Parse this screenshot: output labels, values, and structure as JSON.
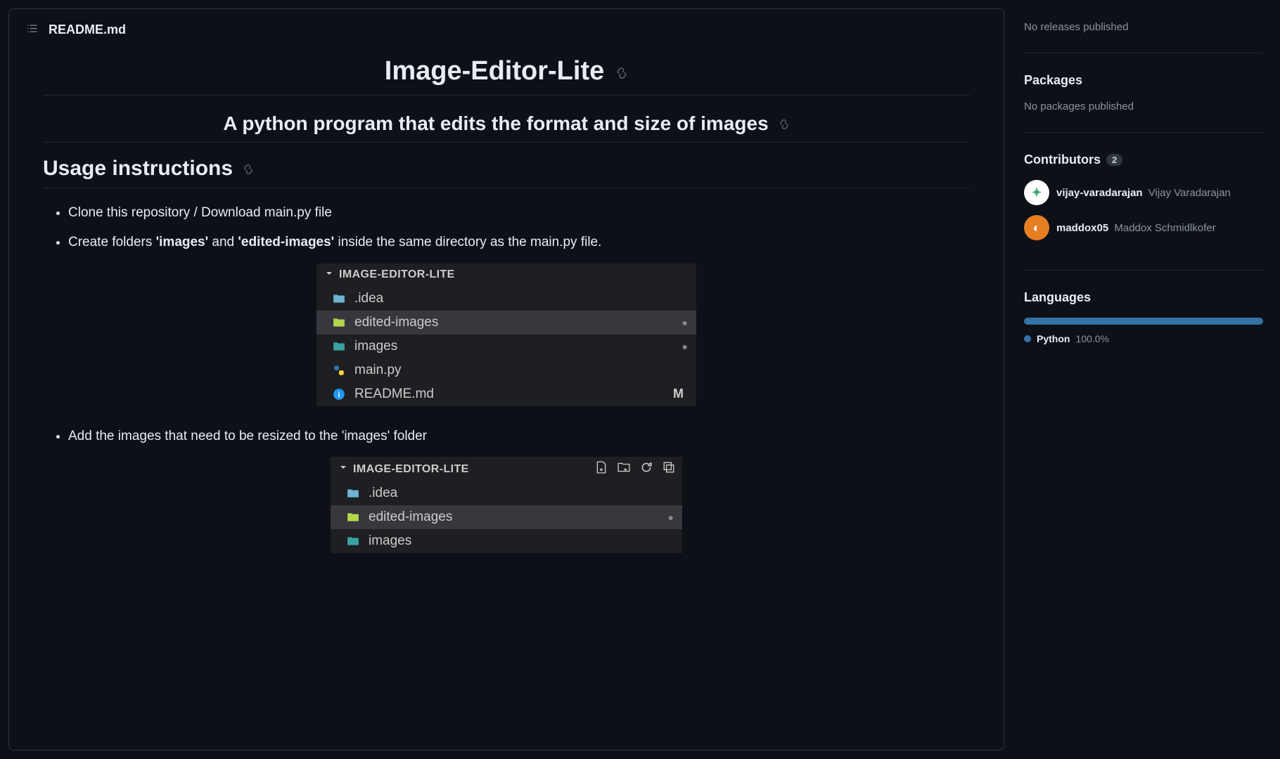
{
  "readme": {
    "filename": "README.md",
    "title": "Image-Editor-Lite",
    "subtitle": "A python program that edits the format and size of images",
    "usage_heading": "Usage instructions",
    "steps": {
      "clone": "Clone this repository / Download main.py file",
      "create_prefix": "Create folders ",
      "create_bold1": "'images'",
      "create_mid": " and ",
      "create_bold2": "'edited-images'",
      "create_suffix": " inside the same directory as the main.py file.",
      "add_images": "Add the images that need to be resized to the 'images' folder"
    },
    "tree1": {
      "root": "IMAGE-EDITOR-LITE",
      "rows": [
        {
          "name": ".idea"
        },
        {
          "name": "edited-images"
        },
        {
          "name": "images"
        },
        {
          "name": "main.py"
        },
        {
          "name": "README.md",
          "marker": "M"
        }
      ]
    },
    "tree2": {
      "root": "IMAGE-EDITOR-LITE",
      "rows": [
        {
          "name": ".idea"
        },
        {
          "name": "edited-images"
        },
        {
          "name": "images"
        }
      ]
    }
  },
  "sidebar": {
    "releases_empty": "No releases published",
    "packages_heading": "Packages",
    "packages_empty": "No packages published",
    "contributors_heading": "Contributors",
    "contributors_count": "2",
    "contributors": [
      {
        "user": "vijay-varadarajan",
        "full": "Vijay Varadarajan"
      },
      {
        "user": "maddox05",
        "full": "Maddox Schmidlkofer"
      }
    ],
    "languages_heading": "Languages",
    "languages": [
      {
        "name": "Python",
        "pct": "100.0%"
      }
    ]
  }
}
